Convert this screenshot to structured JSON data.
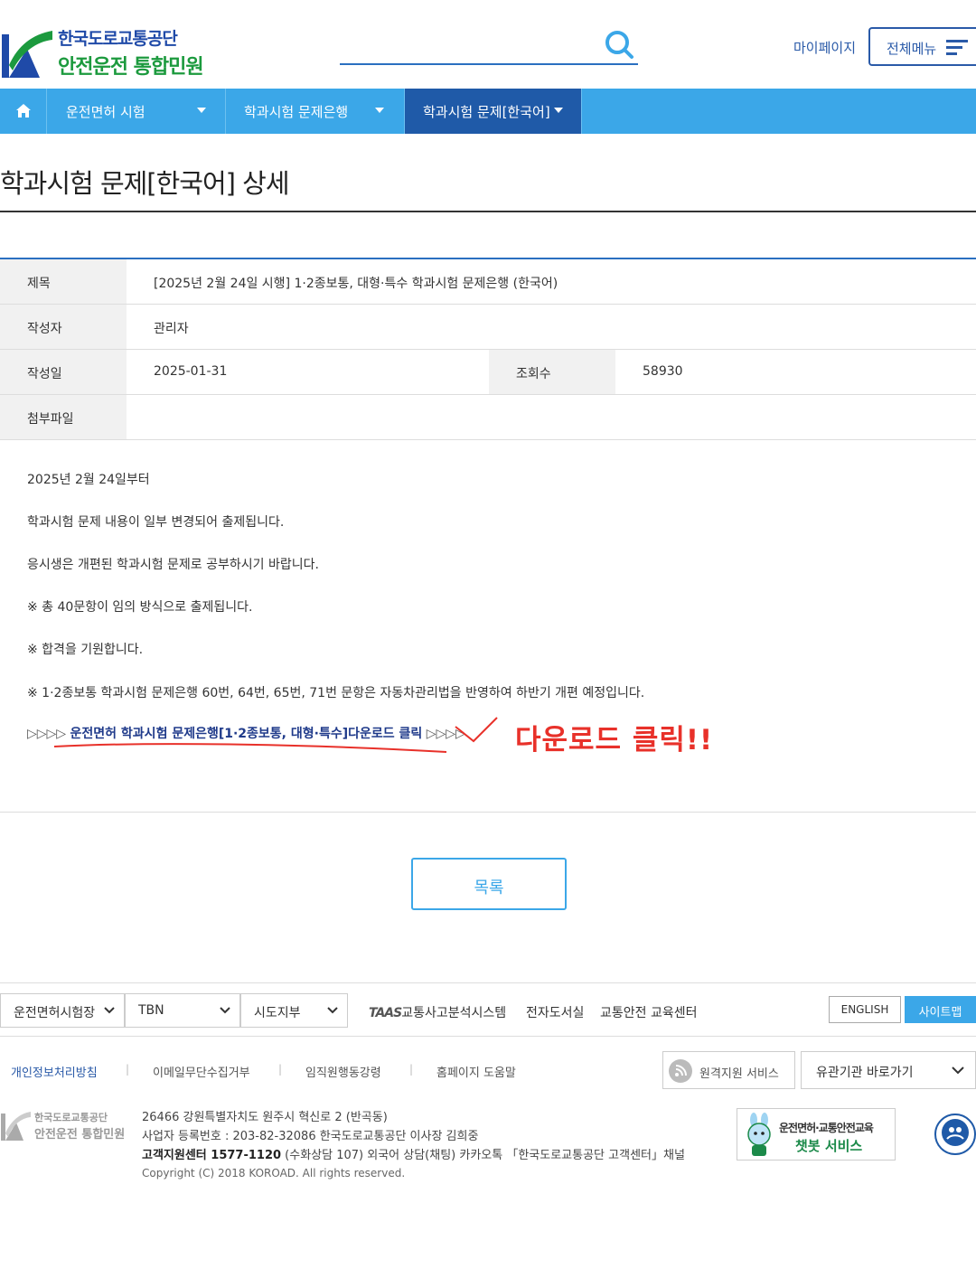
{
  "brand": {
    "line1": "한국도로교통공단",
    "line2": "안전운전 통합민원",
    "colors": {
      "blue": "#1f4aa8",
      "green": "#1c9a3e",
      "nav": "#3ba7e8",
      "nav_active": "#1f5aa8",
      "accent_red": "#e8312a"
    }
  },
  "header": {
    "mypage": "마이페이지",
    "allmenu": "전체메뉴"
  },
  "nav": {
    "items": [
      {
        "label": "운전면허 시험"
      },
      {
        "label": "학과시험 문제은행"
      },
      {
        "label": "학과시험 문제[한국어]"
      }
    ]
  },
  "page": {
    "title": "학과시험 문제[한국어] 상세"
  },
  "info": {
    "subject_label": "제목",
    "subject": "[2025년 2월 24일 시행] 1·2종보통, 대형·특수 학과시험 문제은행 (한국어)",
    "author_label": "작성자",
    "author": "관리자",
    "date_label": "작성일",
    "date": "2025-01-31",
    "views_label": "조회수",
    "views": "58930",
    "attach_label": "첨부파일"
  },
  "content": {
    "lines": [
      "2025년 2월 24일부터",
      "학과시험 문제 내용이 일부 변경되어 출제됩니다.",
      "응시생은 개편된 학과시험 문제로 공부하시기 바랍니다.",
      "※ 총 40문항이 임의 방식으로 출제됩니다.",
      "※ 합격을 기원합니다.",
      "※ 1·2종보통 학과시험 문제은행 60번, 64번, 65번, 71번 문항은 자동차관리법을 반영하여 하반기 개편 예정입니다."
    ],
    "download_prefix": "▷▷▷▷",
    "download_link": "운전면허 학과시험 문제은행[1·2종보통, 대형·특수]다운로드 클릭",
    "download_suffix": "▷▷▷▷",
    "annotation": "다운로드 클릭!!"
  },
  "list_button": "목록",
  "footer": {
    "selects": [
      "운전면허시험장",
      "TBN",
      "시도지부"
    ],
    "taas_mark": "TAAS",
    "links": [
      "교통사고분석시스템",
      "전자도서실",
      "교통안전 교육센터"
    ],
    "english": "ENGLISH",
    "sitemap": "사이트맵",
    "policy_links": [
      "개인정보처리방침",
      "이메일무단수집거부",
      "임직원행동강령",
      "홈페이지 도움말"
    ],
    "remote": "원격지원 서비스",
    "org_select": "유관기관 바로가기",
    "logo_line1": "한국도로교통공단",
    "logo_line2": "안전운전 통합민원",
    "address": "26466 강원특별자치도 원주시 혁신로 2 (반곡동)",
    "biz": "사업자 등록번호 : 203-82-32086 한국도로교통공단 이사장 김희중",
    "center_bold": "고객지원센터 1577-1120",
    "center_rest": " (수화상담 107) 외국어 상담(채팅) 카카오톡 「한국도로교통공단 고객센터」채널",
    "copyright": "Copyright (C) 2018 KOROAD. All rights reserved.",
    "chatbot_line1": "운전면허·교통안전교육",
    "chatbot_line2": "챗봇 서비스"
  }
}
